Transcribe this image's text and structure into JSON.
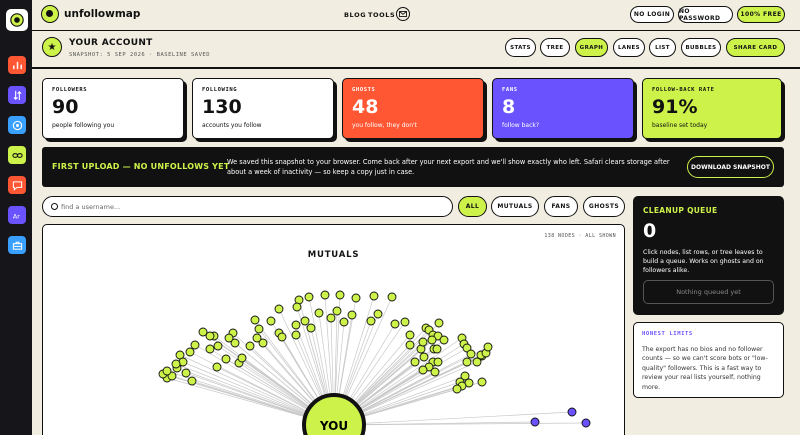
{
  "colors": {
    "accent": "#cdf24a",
    "ghost": "#ff5733",
    "fans": "#6a52ff",
    "dark": "#111111",
    "paper": "#f1ede0"
  },
  "rail": {
    "items": [
      {
        "icon": "logo-icon",
        "color": "#cdf24a"
      },
      {
        "icon": "bar-chart-icon",
        "color": "#ff5733"
      },
      {
        "icon": "swap-arrows-icon",
        "color": "#6a52ff"
      },
      {
        "icon": "target-icon",
        "color": "#3aa0ff"
      },
      {
        "icon": "link-icon",
        "color": "#cdf24a"
      },
      {
        "icon": "chat-icon",
        "color": "#ff5733"
      },
      {
        "icon": "text-ai-icon",
        "color": "#6a52ff"
      },
      {
        "icon": "briefcase-icon",
        "color": "#3aa0ff"
      }
    ]
  },
  "topbar": {
    "brand": "unfollowmap",
    "nav": {
      "blog": "BLOG",
      "tools": "TOOLS"
    },
    "pills": {
      "no_login": "NO LOGIN",
      "no_password": "NO PASSWORD",
      "free": "100% FREE"
    }
  },
  "account": {
    "title": "YOUR ACCOUNT",
    "subtitle": "SNAPSHOT: 5 SEP 2026 · BASELINE SAVED",
    "views": {
      "stats": "STATS",
      "tree": "TREE",
      "graph": "GRAPH",
      "lanes": "LANES",
      "list": "LIST",
      "bubbles": "BUBBLES"
    },
    "share": "SHARE CARD"
  },
  "stats": {
    "followers": {
      "label": "FOLLOWERS",
      "value": "90",
      "note": "people following you"
    },
    "following": {
      "label": "FOLLOWING",
      "value": "130",
      "note": "accounts you follow"
    },
    "ghosts": {
      "label": "GHOSTS",
      "value": "48",
      "note": "you follow, they don't"
    },
    "fans": {
      "label": "FANS",
      "value": "8",
      "note": "follow back?"
    },
    "rate": {
      "label": "FOLLOW-BACK RATE",
      "value": "91%",
      "note": "baseline set today"
    }
  },
  "banner": {
    "title": "FIRST UPLOAD — NO UNFOLLOWS YET",
    "text": "We saved this snapshot to your browser. Come back after your next export and we'll show exactly who left. Safari clears storage after about a week of inactivity — so keep a copy just in case.",
    "button": "DOWNLOAD SNAPSHOT"
  },
  "search": {
    "placeholder": "find a username..."
  },
  "filters": {
    "all": "ALL",
    "mutuals": "MUTUALS",
    "fans": "FANS",
    "ghosts": "GHOSTS"
  },
  "graph": {
    "meta": "138 NODES · ALL SHOWN",
    "title": "MUTUALS",
    "center": "YOU"
  },
  "queue": {
    "title": "CLEANUP QUEUE",
    "count": "0",
    "text": "Click nodes, list rows, or tree leaves to build a queue. Works on ghosts and on followers alike.",
    "button": "Nothing queued yet"
  },
  "limits": {
    "title": "HONEST LIMITS",
    "text": "The export has no bios and no follower counts — so we can't score bots or \"low-quality\" followers. This is a fast way to review your real lists yourself, nothing more."
  }
}
